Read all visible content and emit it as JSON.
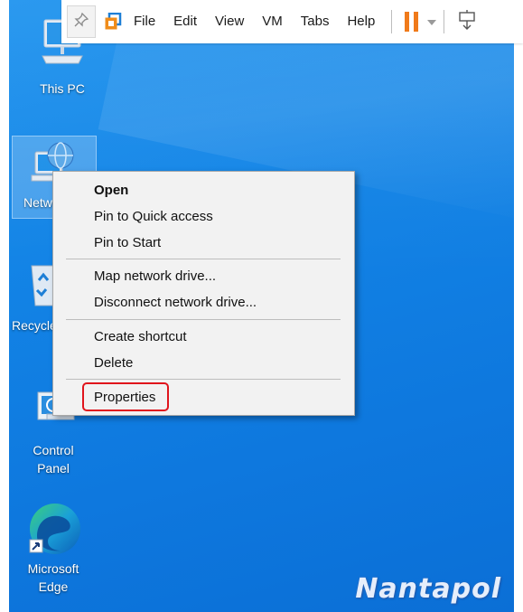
{
  "toolbar": {
    "menus": [
      "File",
      "Edit",
      "View",
      "VM",
      "Tabs",
      "Help"
    ]
  },
  "desktop": {
    "icons": {
      "this_pc": "This PC",
      "network": "Network",
      "recycle_bin": "Recycle Bin",
      "control_panel_line1": "Control",
      "control_panel_line2": "Panel",
      "edge_line1": "Microsoft",
      "edge_line2": "Edge"
    }
  },
  "context_menu": {
    "items": [
      "Open",
      "Pin to Quick access",
      "Pin to Start",
      "Map network drive...",
      "Disconnect network drive...",
      "Create shortcut",
      "Delete",
      "Properties"
    ]
  },
  "watermark": "Nantapol",
  "colors": {
    "desktop_bg": "#1384e6",
    "highlight": "#e0141c",
    "pause": "#f07a1a"
  }
}
